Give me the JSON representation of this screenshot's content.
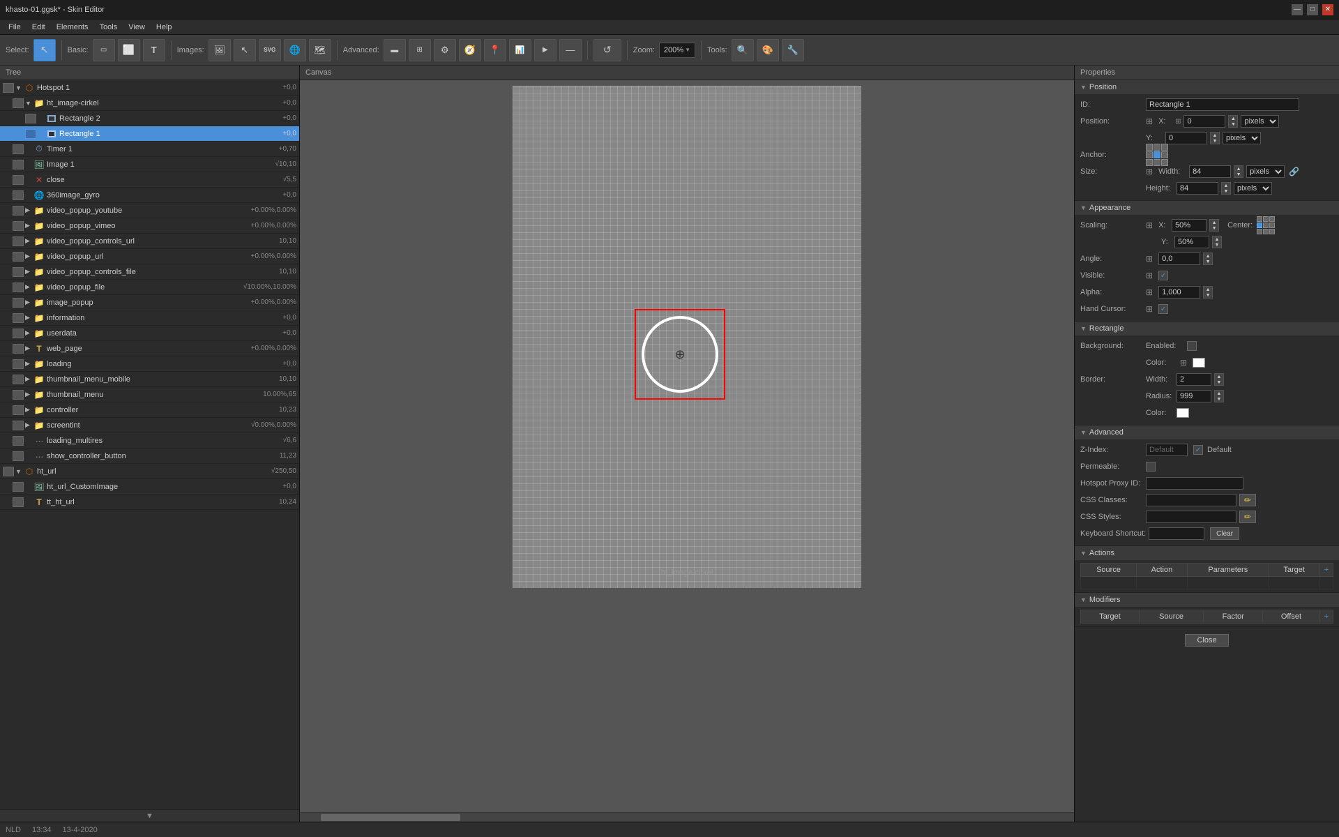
{
  "titlebar": {
    "title": "khasto-01.ggsk* - Skin Editor",
    "min_label": "—",
    "max_label": "□",
    "close_label": "✕"
  },
  "menubar": {
    "items": [
      "File",
      "Edit",
      "Elements",
      "Tools",
      "View",
      "Help"
    ]
  },
  "toolbar": {
    "select_label": "Select:",
    "basic_label": "Basic:",
    "images_label": "Images:",
    "advanced_label": "Advanced:",
    "zoom_label": "Zoom:",
    "zoom_value": "200%",
    "tools_label": "Tools:"
  },
  "tree": {
    "header": "Tree",
    "items": [
      {
        "id": "hotspot1",
        "label": "Hotspot 1",
        "value": "+0,0",
        "level": 0,
        "type": "hotspot",
        "expanded": true
      },
      {
        "id": "ht_image_cirkel",
        "label": "ht_image-cirkel",
        "value": "+0,0",
        "level": 1,
        "type": "folder",
        "expanded": true
      },
      {
        "id": "rectangle2",
        "label": "Rectangle 2",
        "value": "+0,0",
        "level": 2,
        "type": "rect"
      },
      {
        "id": "rectangle1",
        "label": "Rectangle 1",
        "value": "+0,0",
        "level": 2,
        "type": "rect",
        "selected": true
      },
      {
        "id": "timer1",
        "label": "Timer 1",
        "value": "+0,70",
        "level": 1,
        "type": "timer"
      },
      {
        "id": "image1",
        "label": "Image 1",
        "value": "√10,10",
        "level": 1,
        "type": "image"
      },
      {
        "id": "close",
        "label": "close",
        "value": "√5,5",
        "level": 1,
        "type": "close"
      },
      {
        "id": "360image_gyro",
        "label": "360image_gyro",
        "value": "+0,0",
        "level": 1,
        "type": "gyro"
      },
      {
        "id": "video_popup_youtube",
        "label": "video_popup_youtube",
        "value": "+0.00%,0.00%",
        "level": 1,
        "type": "folder"
      },
      {
        "id": "video_popup_vimeo",
        "label": "video_popup_vimeo",
        "value": "+0.00%,0.00%",
        "level": 1,
        "type": "folder"
      },
      {
        "id": "video_popup_controls_url",
        "label": "video_popup_controls_url",
        "value": "10,10",
        "level": 1,
        "type": "folder"
      },
      {
        "id": "video_popup_url",
        "label": "video_popup_url",
        "value": "+0.00%,0.00%",
        "level": 1,
        "type": "folder"
      },
      {
        "id": "video_popup_controls_file",
        "label": "video_popup_controls_file",
        "value": "10,10",
        "level": 1,
        "type": "folder"
      },
      {
        "id": "video_popup_file",
        "label": "video_popup_file",
        "value": "√10.00%,10.00%",
        "level": 1,
        "type": "folder"
      },
      {
        "id": "image_popup",
        "label": "image_popup",
        "value": "+0.00%,0.00%",
        "level": 1,
        "type": "folder"
      },
      {
        "id": "information",
        "label": "information",
        "value": "+0,0",
        "level": 1,
        "type": "folder"
      },
      {
        "id": "userdata",
        "label": "userdata",
        "value": "+0,0",
        "level": 1,
        "type": "folder"
      },
      {
        "id": "web_page",
        "label": "web_page",
        "value": "+0.00%,0.00%",
        "level": 1,
        "type": "text"
      },
      {
        "id": "loading",
        "label": "loading",
        "value": "+0,0",
        "level": 1,
        "type": "folder"
      },
      {
        "id": "thumbnail_menu_mobile",
        "label": "thumbnail_menu_mobile",
        "value": "10,10",
        "level": 1,
        "type": "folder"
      },
      {
        "id": "thumbnail_menu",
        "label": "thumbnail_menu",
        "value": "10.00%,65",
        "level": 1,
        "type": "folder"
      },
      {
        "id": "controller",
        "label": "controller",
        "value": "10,23",
        "level": 1,
        "type": "folder"
      },
      {
        "id": "screentint",
        "label": "screentint",
        "value": "√0.00%,0.00%",
        "level": 1,
        "type": "folder"
      },
      {
        "id": "loading_multires",
        "label": "loading_multires",
        "value": "√6,6",
        "level": 1,
        "type": "dots"
      },
      {
        "id": "show_controller_button",
        "label": "show_controller_button",
        "value": "11,23",
        "level": 1,
        "type": "dots"
      },
      {
        "id": "ht_url",
        "label": "ht_url",
        "value": "√250,50",
        "level": 0,
        "type": "hotspot",
        "expanded": true
      },
      {
        "id": "ht_url_CustomImage",
        "label": "ht_url_CustomImage",
        "value": "+0,0",
        "level": 1,
        "type": "image"
      },
      {
        "id": "tt_ht_url",
        "label": "tt_ht_url",
        "value": "10,24",
        "level": 1,
        "type": "text"
      }
    ]
  },
  "canvas": {
    "header": "Canvas",
    "element_label": "ht_image-cirkel"
  },
  "properties": {
    "header": "Properties",
    "sections": {
      "position": {
        "title": "Position",
        "id_label": "ID:",
        "id_value": "Rectangle 1",
        "position_label": "Position:",
        "x_label": "X:",
        "x_value": "0",
        "y_label": "Y:",
        "y_value": "0",
        "pixels_label": "pixels",
        "anchor_label": "Anchor:",
        "size_label": "Size:",
        "width_label": "Width:",
        "width_value": "84",
        "height_label": "Height:",
        "height_value": "84"
      },
      "appearance": {
        "title": "Appearance",
        "scaling_label": "Scaling:",
        "x_scale": "50%",
        "y_scale": "50%",
        "center_label": "Center:",
        "angle_label": "Angle:",
        "angle_value": "0,0",
        "visible_label": "Visible:",
        "alpha_label": "Alpha:",
        "alpha_value": "1,000",
        "hand_cursor_label": "Hand Cursor:"
      },
      "rectangle": {
        "title": "Rectangle",
        "background_label": "Background:",
        "enabled_label": "Enabled:",
        "color_label": "Color:",
        "border_label": "Border:",
        "width_label": "Width:",
        "border_width": "2",
        "radius_label": "Radius:",
        "radius_value": "999",
        "color2_label": "Color:"
      },
      "advanced": {
        "title": "Advanced",
        "zindex_label": "Z-Index:",
        "zindex_value": "Default",
        "default_label": "Default",
        "permeable_label": "Permeable:",
        "hotspot_proxy_label": "Hotspot Proxy ID:",
        "css_classes_label": "CSS Classes:",
        "css_styles_label": "CSS Styles:",
        "keyboard_label": "Keyboard Shortcut:",
        "clear_label": "Clear"
      },
      "actions": {
        "title": "Actions",
        "columns": [
          "Source",
          "Action",
          "Parameters",
          "Target"
        ]
      },
      "modifiers": {
        "title": "Modifiers",
        "columns": [
          "Target",
          "Source",
          "Factor",
          "Offset"
        ]
      }
    },
    "close_label": "Close"
  },
  "statusbar": {
    "time": "13:34",
    "date": "13-4-2020",
    "locale": "NLD"
  }
}
